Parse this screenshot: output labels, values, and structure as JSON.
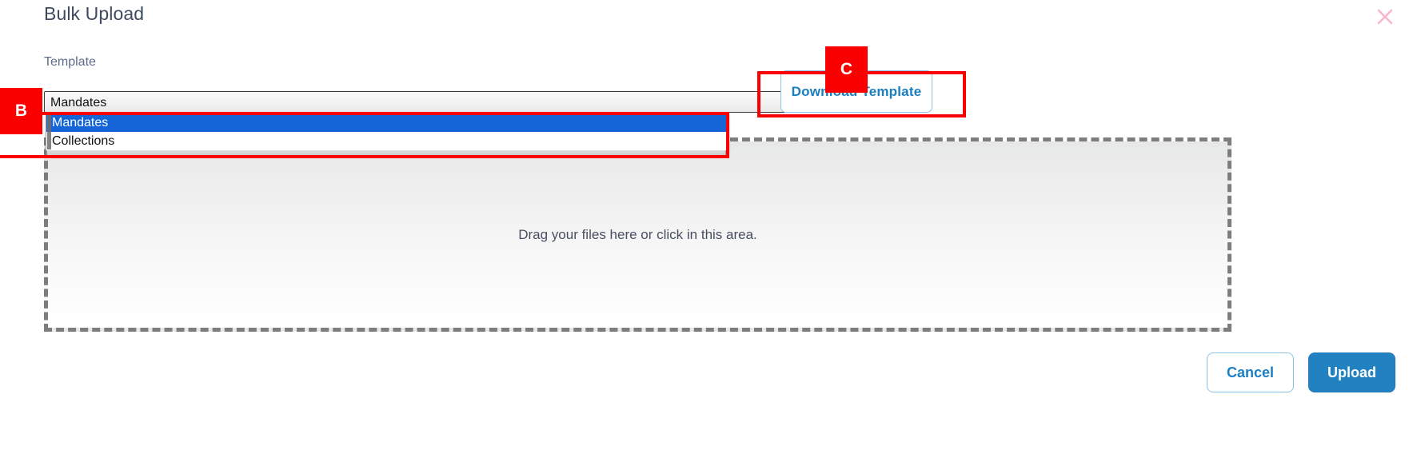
{
  "dialog": {
    "title": "Bulk Upload",
    "close_icon": "close-icon"
  },
  "template_field": {
    "label": "Template",
    "selected_value": "Mandates",
    "chevron_icon": "chevron-down-icon",
    "options": [
      {
        "label": "Mandates",
        "selected": true
      },
      {
        "label": "Collections",
        "selected": false
      }
    ]
  },
  "download_template": {
    "label": "Download Template"
  },
  "dropzone": {
    "text": "Drag your files here or click in this area."
  },
  "footer": {
    "cancel_label": "Cancel",
    "upload_label": "Upload"
  },
  "annotations": [
    {
      "badge": "B"
    },
    {
      "badge": "C"
    }
  ],
  "colors": {
    "accent_blue": "#2281c0",
    "link_blue": "#1a7fc1",
    "annotation_red": "#fb0000",
    "option_highlight": "#1565d8",
    "title_text": "#3f4a60",
    "label_text": "#5d6c8a",
    "dropzone_border": "#7d7d7d",
    "close_icon": "#f9b6ca"
  }
}
